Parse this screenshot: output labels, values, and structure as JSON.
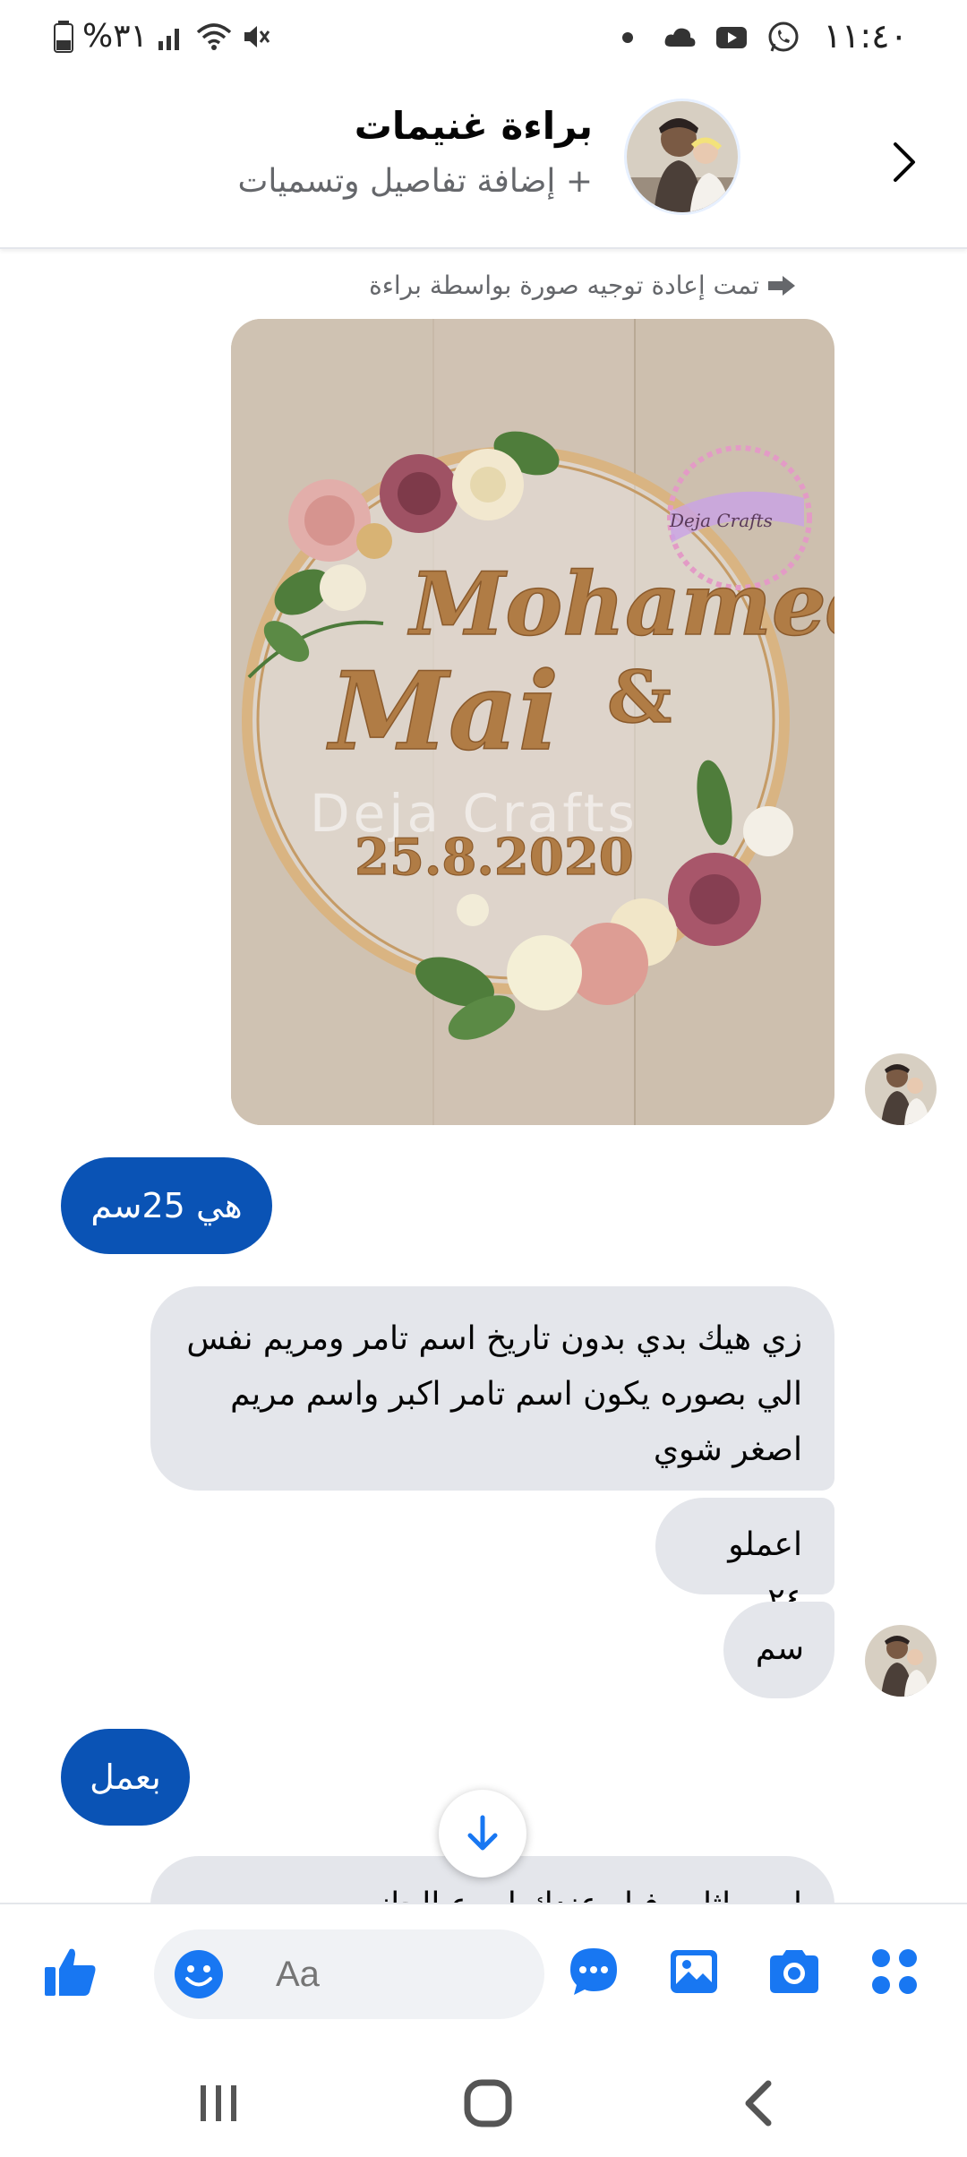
{
  "status_bar": {
    "time": "١١:٤٠",
    "battery": "%٣١",
    "icons": [
      "whatsapp-icon",
      "youtube-icon",
      "cloud-icon",
      "dot-icon",
      "mute-icon",
      "wifi-icon",
      "signal-icon",
      "battery-icon"
    ]
  },
  "header": {
    "title": "براءة غنيمات",
    "subtitle": "+ إضافة تفاصيل وتسميات"
  },
  "messages": {
    "forward_note": "تمت إعادة توجيه صورة بواسطة براءة",
    "photo": {
      "watermark": "Deja Crafts",
      "badge": "Deja Crafts",
      "name1": "Mohamed",
      "amp": "&",
      "name2": "Mai",
      "date": "25.8.2020"
    },
    "out1": "هي 25سم",
    "in1": "زي هيك بدي بدون تاريخ  اسم تامر  ومريم نفس الي بصوره  يكون اسم تامر اكبر واسم مريم اصغر شوي",
    "in2": "اعملو ٢٤",
    "in3": "سم",
    "out2": "بعمل",
    "in4_partial": "او مماثله وفيل عندك ليه ع الجانب"
  },
  "composer": {
    "placeholder": "Aa"
  },
  "colors": {
    "brand": "#0a53b5",
    "icon_blue": "#1877f2",
    "bubble_in": "#e4e6eb"
  }
}
